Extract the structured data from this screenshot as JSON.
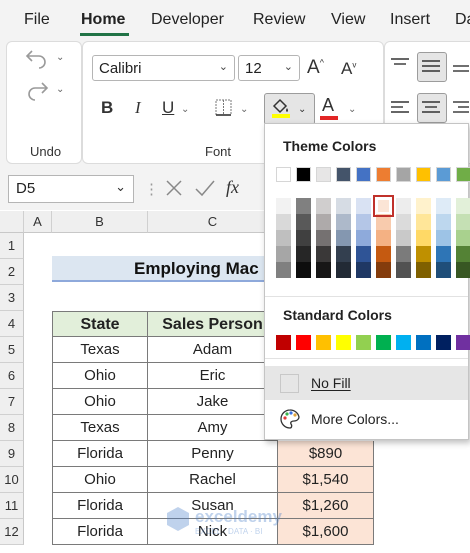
{
  "menu": {
    "items": [
      {
        "label": "File",
        "active": false
      },
      {
        "label": "Home",
        "active": true
      },
      {
        "label": "Developer",
        "active": false
      },
      {
        "label": "Review",
        "active": false
      },
      {
        "label": "View",
        "active": false
      },
      {
        "label": "Insert",
        "active": false
      },
      {
        "label": "Da",
        "active": false
      }
    ]
  },
  "ribbon": {
    "undo_group_label": "Undo",
    "font_group_label": "Font",
    "font_name": "Calibri",
    "font_size": "12",
    "font_color": "#e32626",
    "fill_color": "#ffff00"
  },
  "formula_bar": {
    "name_box": "D5",
    "fx_label": "fx"
  },
  "sheet": {
    "columns": [
      "A",
      "B",
      "C"
    ],
    "rows": [
      "1",
      "2",
      "3",
      "4",
      "5",
      "6",
      "7",
      "8",
      "9",
      "10",
      "11",
      "12"
    ],
    "title": "Employing Mac",
    "headers": [
      "State",
      "Sales Person"
    ],
    "data": [
      {
        "state": "Texas",
        "person": "Adam",
        "sales": ""
      },
      {
        "state": "Ohio",
        "person": "Eric",
        "sales": ""
      },
      {
        "state": "Ohio",
        "person": "Jake",
        "sales": ""
      },
      {
        "state": "Texas",
        "person": "Amy",
        "sales": ""
      },
      {
        "state": "Florida",
        "person": "Penny",
        "sales": "$890"
      },
      {
        "state": "Ohio",
        "person": "Rachel",
        "sales": "$1,540"
      },
      {
        "state": "Florida",
        "person": "Susan",
        "sales": "$1,260"
      },
      {
        "state": "Florida",
        "person": "Nick",
        "sales": "$1,600"
      }
    ],
    "watermark": "exceldemy",
    "watermark_sub": "EXCEL · DATA · BI"
  },
  "color_dropdown": {
    "theme_title": "Theme Colors",
    "standard_title": "Standard Colors",
    "no_fill": "No Fill",
    "more_colors": "More Colors...",
    "theme_base": [
      "#ffffff",
      "#000000",
      "#e7e6e6",
      "#44546a",
      "#4472c4",
      "#ed7d31",
      "#a5a5a5",
      "#ffc000",
      "#5b9bd5",
      "#70ad47"
    ],
    "theme_shades": [
      [
        "#f2f2f2",
        "#d9d9d9",
        "#bfbfbf",
        "#a6a6a6",
        "#808080"
      ],
      [
        "#808080",
        "#595959",
        "#404040",
        "#262626",
        "#0d0d0d"
      ],
      [
        "#d0cece",
        "#aeaaaa",
        "#757171",
        "#3a3838",
        "#171616"
      ],
      [
        "#d6dce4",
        "#adb9ca",
        "#8497b0",
        "#333f4f",
        "#222a35"
      ],
      [
        "#d9e2f3",
        "#b4c6e7",
        "#8eaadb",
        "#2f5496",
        "#1f3864"
      ],
      [
        "#fbe5d6",
        "#f8cbad",
        "#f4b183",
        "#c55a11",
        "#843c0c"
      ],
      [
        "#ededed",
        "#dbdbdb",
        "#c9c9c9",
        "#7b7b7b",
        "#525252"
      ],
      [
        "#fff2cc",
        "#ffe699",
        "#ffd966",
        "#bf9000",
        "#7f6000"
      ],
      [
        "#deebf7",
        "#bdd7ee",
        "#9dc3e6",
        "#2e75b6",
        "#1f4e79"
      ],
      [
        "#e2f0d9",
        "#c5e0b4",
        "#a9d18e",
        "#548235",
        "#385723"
      ]
    ],
    "selected": {
      "column": 5,
      "row": 0
    },
    "standard": [
      "#c00000",
      "#ff0000",
      "#ffc000",
      "#ffff00",
      "#92d050",
      "#00b050",
      "#00b0f0",
      "#0070c0",
      "#002060",
      "#7030a0"
    ]
  }
}
